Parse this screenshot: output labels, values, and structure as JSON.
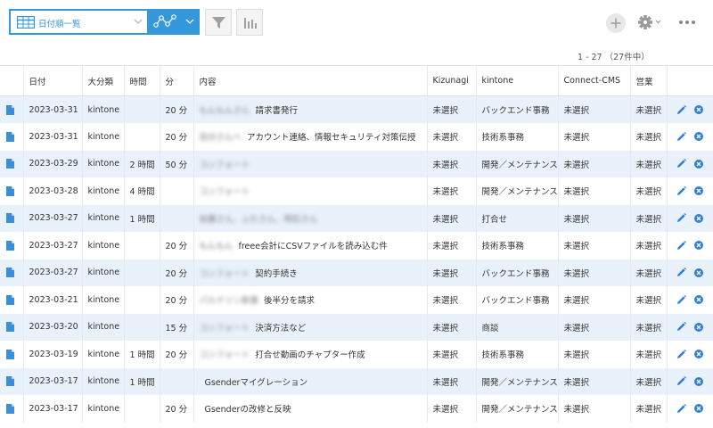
{
  "toolbar": {
    "view_name": "日付順一覧",
    "colors": {
      "accent": "#3498db",
      "icon_gray": "#a0a0a0",
      "delete": "#2f80d6"
    },
    "icons": [
      "table-view-icon",
      "chevron-down-icon",
      "graph-icon",
      "filter-icon",
      "bar-chart-icon",
      "plus-icon",
      "gear-icon",
      "more-icon"
    ]
  },
  "pager": {
    "text": "1 - 27 （27件中）"
  },
  "table": {
    "headers": [
      "日付",
      "大分類",
      "時間",
      "分",
      "内容",
      "Kizunagi",
      "kintone",
      "Connect-CMS",
      "営業"
    ],
    "rows": [
      {
        "date": "2023-03-31",
        "cat": "kintone",
        "hours": "",
        "mins": "20 分",
        "blur": "もんもんさん",
        "content": "請求書発行",
        "kizunagi": "未選択",
        "kintone": "バックエンド事務",
        "cms": "未選択",
        "sales": "未選択"
      },
      {
        "date": "2023-03-31",
        "cat": "kintone",
        "hours": "",
        "mins": "20 分",
        "blur": "自分さんへ",
        "content": "アカウント連絡、情報セキュリティ対策伝授",
        "kizunagi": "未選択",
        "kintone": "技術系事務",
        "cms": "未選択",
        "sales": "未選択"
      },
      {
        "date": "2023-03-29",
        "cat": "kintone",
        "hours": "2 時間",
        "mins": "50 分",
        "blur": "コンフォート",
        "content": "",
        "kizunagi": "未選択",
        "kintone": "開発／メンテナンス",
        "cms": "未選択",
        "sales": "未選択"
      },
      {
        "date": "2023-03-28",
        "cat": "kintone",
        "hours": "4 時間",
        "mins": "",
        "blur": "コンフォート",
        "content": "",
        "kizunagi": "未選択",
        "kintone": "開発／メンテナンス",
        "cms": "未選択",
        "sales": "未選択"
      },
      {
        "date": "2023-03-27",
        "cat": "kintone",
        "hours": "1 時間",
        "mins": "",
        "blur": "佐藤さん、ふたさん、明石さん",
        "content": "",
        "kizunagi": "未選択",
        "kintone": "打合せ",
        "cms": "未選択",
        "sales": "未選択"
      },
      {
        "date": "2023-03-27",
        "cat": "kintone",
        "hours": "",
        "mins": "20 分",
        "blur": "もんもん",
        "content": "freee会計にCSVファイルを読み込む件",
        "kizunagi": "未選択",
        "kintone": "技術系事務",
        "cms": "未選択",
        "sales": "未選択"
      },
      {
        "date": "2023-03-27",
        "cat": "kintone",
        "hours": "",
        "mins": "20 分",
        "blur": "コンフォート",
        "content": "契約手続き",
        "kizunagi": "未選択",
        "kintone": "バックエンド事務",
        "cms": "未選択",
        "sales": "未選択"
      },
      {
        "date": "2023-03-21",
        "cat": "kintone",
        "hours": "",
        "mins": "20 分",
        "blur": "パルナソン新書",
        "content": "後半分を請求",
        "kizunagi": "未選択",
        "kintone": "バックエンド事務",
        "cms": "未選択",
        "sales": "未選択"
      },
      {
        "date": "2023-03-20",
        "cat": "kintone",
        "hours": "",
        "mins": "15 分",
        "blur": "コンフォート",
        "content": "決済方法など",
        "kizunagi": "未選択",
        "kintone": "商談",
        "cms": "未選択",
        "sales": "未選択"
      },
      {
        "date": "2023-03-19",
        "cat": "kintone",
        "hours": "1 時間",
        "mins": "20 分",
        "blur": "コンフォート",
        "content": "打合せ動画のチャプター作成",
        "kizunagi": "未選択",
        "kintone": "技術系事務",
        "cms": "未選択",
        "sales": "未選択"
      },
      {
        "date": "2023-03-17",
        "cat": "kintone",
        "hours": "1 時間",
        "mins": "",
        "blur": "",
        "content": "Gsenderマイグレーション",
        "kizunagi": "未選択",
        "kintone": "開発／メンテナンス",
        "cms": "未選択",
        "sales": "未選択"
      },
      {
        "date": "2023-03-17",
        "cat": "kintone",
        "hours": "",
        "mins": "20 分",
        "blur": "",
        "content": "Gsenderの改修と反映",
        "kizunagi": "未選択",
        "kintone": "開発／メンテナンス",
        "cms": "未選択",
        "sales": "未選択"
      }
    ]
  }
}
